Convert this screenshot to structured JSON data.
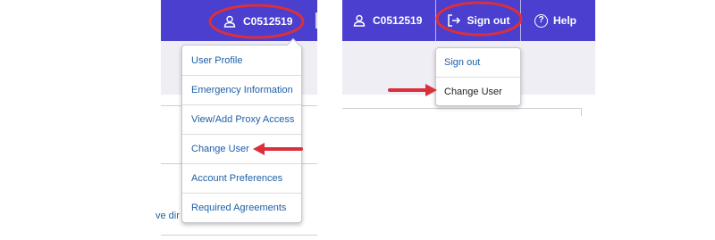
{
  "left_panel": {
    "user_id": "C0512519",
    "menu_items": [
      "User Profile",
      "Emergency Information",
      "View/Add Proxy Access",
      "Change User",
      "Account Preferences",
      "Required Agreements"
    ],
    "truncated_text": "ve dir"
  },
  "right_panel": {
    "user_id": "C0512519",
    "sign_out_label": "Sign out",
    "help_label": "Help",
    "help_symbol": "?",
    "menu_items": [
      "Sign out",
      "Change User"
    ]
  },
  "colors": {
    "header_bg": "#4a3fcf",
    "link": "#1d5fa8",
    "annotation_red": "#d9303c"
  },
  "icons": [
    "user-icon",
    "sign-out-icon",
    "help-icon",
    "red-arrow-annotation",
    "red-ellipse-annotation"
  ]
}
